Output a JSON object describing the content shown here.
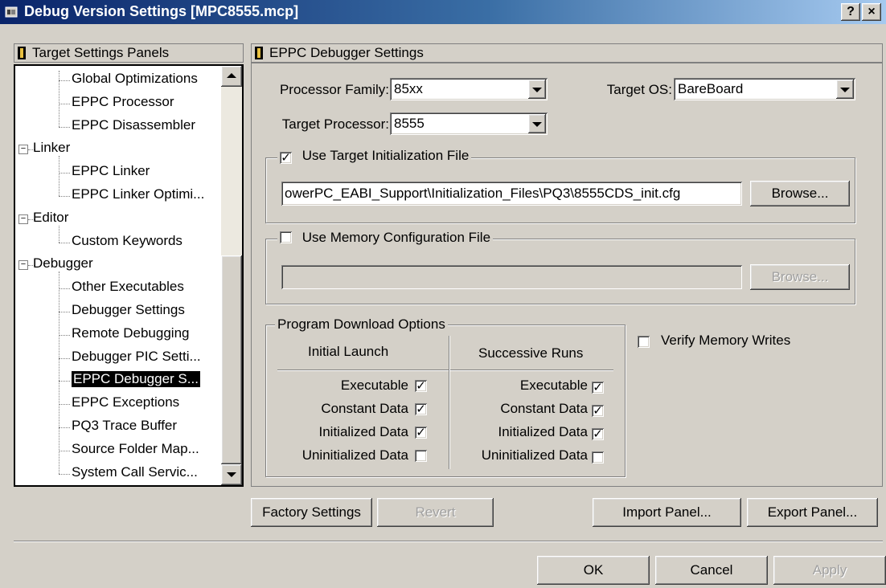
{
  "window": {
    "title": "Debug Version Settings [MPC8555.mcp]",
    "help_btn": "?",
    "close_btn": "×"
  },
  "left_panel": {
    "header": "Target Settings Panels",
    "tree": [
      {
        "label": "Global Optimizations",
        "level": 1
      },
      {
        "label": "EPPC Processor",
        "level": 1
      },
      {
        "label": "EPPC Disassembler",
        "level": 1
      },
      {
        "label": "Linker",
        "level": 0,
        "expanded": true
      },
      {
        "label": "EPPC Linker",
        "level": 1
      },
      {
        "label": "EPPC Linker Optimi...",
        "level": 1
      },
      {
        "label": "Editor",
        "level": 0,
        "expanded": true
      },
      {
        "label": "Custom Keywords",
        "level": 1
      },
      {
        "label": "Debugger",
        "level": 0,
        "expanded": true
      },
      {
        "label": "Other Executables",
        "level": 1
      },
      {
        "label": "Debugger Settings",
        "level": 1
      },
      {
        "label": "Remote Debugging",
        "level": 1
      },
      {
        "label": "Debugger PIC Setti...",
        "level": 1
      },
      {
        "label": "EPPC Debugger S...",
        "level": 1,
        "selected": true
      },
      {
        "label": "EPPC Exceptions",
        "level": 1
      },
      {
        "label": "PQ3 Trace Buffer",
        "level": 1
      },
      {
        "label": "Source Folder Map...",
        "level": 1
      },
      {
        "label": "System Call Servic...",
        "level": 1
      }
    ],
    "expander": "−"
  },
  "right_panel": {
    "header": "EPPC Debugger Settings",
    "processor_family": {
      "label": "Processor Family:",
      "value": "85xx"
    },
    "target_os": {
      "label": "Target OS:",
      "value": "BareBoard"
    },
    "target_processor": {
      "label": "Target Processor:",
      "value": "8555"
    },
    "init_file": {
      "label": "Use Target Initialization File",
      "checked": true,
      "path": "owerPC_EABI_Support\\Initialization_Files\\PQ3\\8555CDS_init.cfg",
      "browse": "Browse..."
    },
    "mem_file": {
      "label": "Use Memory Configuration File",
      "checked": false,
      "path": "",
      "browse": "Browse..."
    },
    "download": {
      "title": "Program Download Options",
      "col1": "Initial Launch",
      "col2": "Successive Runs",
      "rows": [
        {
          "label": "Executable",
          "initial": true,
          "successive": true
        },
        {
          "label": "Constant Data",
          "initial": true,
          "successive": true
        },
        {
          "label": "Initialized Data",
          "initial": true,
          "successive": true
        },
        {
          "label": "Uninitialized Data",
          "initial": false,
          "successive": false
        }
      ]
    },
    "verify": {
      "label": "Verify Memory Writes",
      "checked": false
    }
  },
  "panel_buttons": {
    "factory": "Factory Settings",
    "revert": "Revert",
    "import": "Import Panel...",
    "export": "Export Panel..."
  },
  "dialog_buttons": {
    "ok": "OK",
    "cancel": "Cancel",
    "apply": "Apply"
  },
  "check_mark": "✓"
}
